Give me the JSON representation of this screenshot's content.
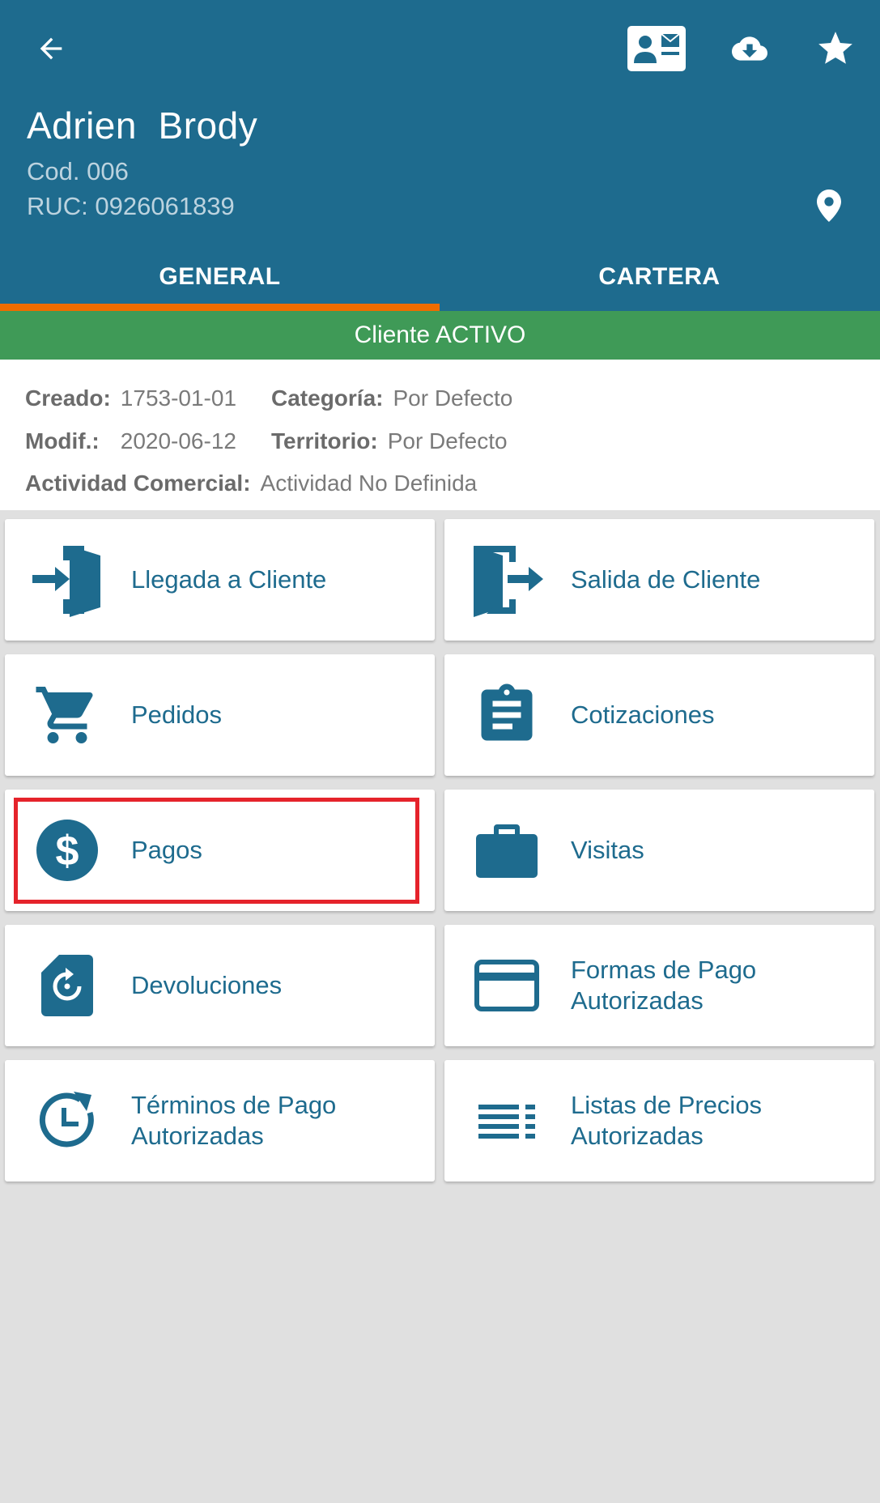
{
  "header": {
    "client_first_name": "Adrien",
    "client_last_name": "Brody",
    "code": "Cod. 006",
    "ruc": "RUC: 0926061839",
    "bg_color": "#1e6b8e"
  },
  "tabs": [
    {
      "label": "GENERAL",
      "active": true
    },
    {
      "label": "CARTERA",
      "active": false
    }
  ],
  "status": {
    "text": "Cliente ACTIVO",
    "color": "#3f9a57"
  },
  "info": {
    "created_label": "Creado:",
    "created_value": "1753-01-01",
    "category_label": "Categoría:",
    "category_value": "Por Defecto",
    "modified_label": "Modif.:",
    "modified_value": "2020-06-12",
    "territory_label": "Territorio:",
    "territory_value": "Por Defecto",
    "activity_label": "Actividad Comercial:",
    "activity_value": "Actividad No Definida"
  },
  "actions": {
    "llegada": {
      "label": "Llegada a Cliente",
      "icon": "enter-door-icon"
    },
    "salida": {
      "label": "Salida de Cliente",
      "icon": "exit-door-icon"
    },
    "pedidos": {
      "label": "Pedidos",
      "icon": "cart-icon"
    },
    "cotizaciones": {
      "label": "Cotizaciones",
      "icon": "clipboard-icon"
    },
    "pagos": {
      "label": "Pagos",
      "icon": "dollar-icon",
      "highlighted": true
    },
    "visitas": {
      "label": "Visitas",
      "icon": "briefcase-icon"
    },
    "devoluciones": {
      "label": "Devoluciones",
      "icon": "return-document-icon"
    },
    "formas_pago": {
      "label_line1": "Formas de Pago",
      "label_line2": "Autorizadas",
      "icon": "credit-card-icon"
    },
    "terminos_pago": {
      "label_line1": "Términos de Pago",
      "label_line2": "Autorizadas",
      "icon": "clock-history-icon"
    },
    "listas_precios": {
      "label_line1": "Listas de Precios",
      "label_line2": "Autorizadas",
      "icon": "list-icon"
    }
  },
  "colors": {
    "accent": "#1e6b8e",
    "tab_indicator": "#ef6c00",
    "highlight": "#e5232b"
  }
}
